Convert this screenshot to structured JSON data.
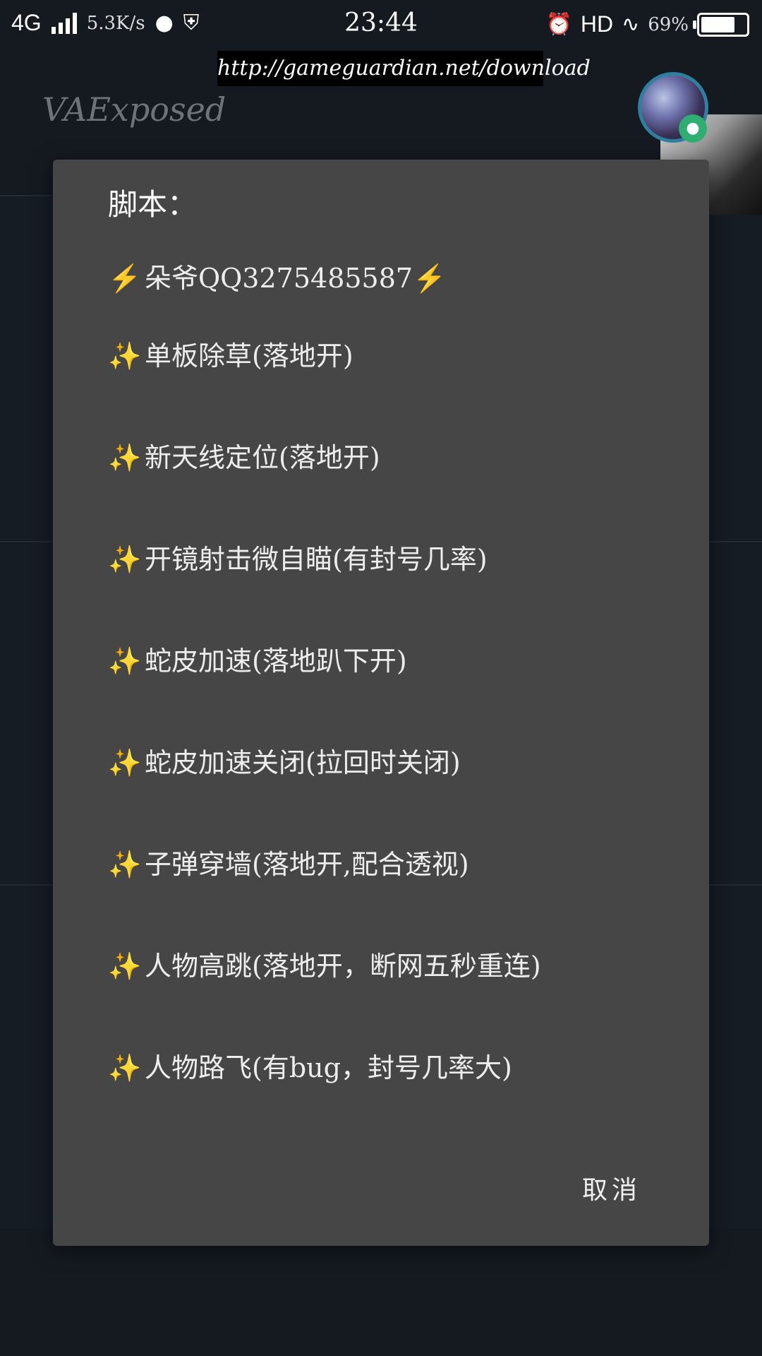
{
  "status_bar": {
    "network": "4G",
    "speed": "5.3K/s",
    "time": "23:44",
    "hd": "HD",
    "battery_percent": "69%",
    "battery_level": 0.69
  },
  "url_banner": "http://gameguardian.net/download",
  "app": {
    "title": "VAExposed"
  },
  "dialog": {
    "title": "脚本：",
    "items": [
      {
        "icon": "lightning-icon",
        "label": "朵爷QQ3275485587"
      },
      {
        "icon": "sparkles-icon",
        "label": "单板除草(落地开)"
      },
      {
        "icon": "sparkles-icon",
        "label": "新天线定位(落地开)"
      },
      {
        "icon": "sparkles-icon",
        "label": "开镜射击微自瞄(有封号几率)"
      },
      {
        "icon": "sparkles-icon",
        "label": "蛇皮加速(落地趴下开)"
      },
      {
        "icon": "sparkles-icon",
        "label": "蛇皮加速关闭(拉回时关闭)"
      },
      {
        "icon": "sparkles-icon",
        "label": "子弹穿墙(落地开,配合透视)"
      },
      {
        "icon": "sparkles-icon",
        "label": "人物高跳(落地开，断网五秒重连)"
      },
      {
        "icon": "sparkles-icon",
        "label": "人物路飞(有bug，封号几率大)"
      }
    ],
    "cancel_label": "取消"
  },
  "colors": {
    "background": "#151a21",
    "dialog": "#464646",
    "sparkle": "#f5c542",
    "accent_avatar_ring": "#2f7fa0",
    "mic_badge": "#2fae72"
  }
}
